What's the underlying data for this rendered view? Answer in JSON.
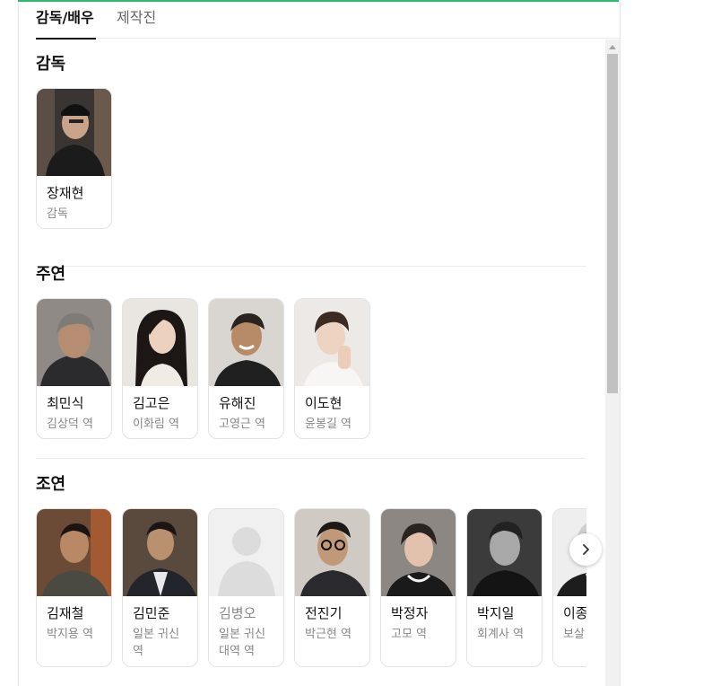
{
  "tabs": [
    {
      "label": "감독/배우",
      "active": true
    },
    {
      "label": "제작진",
      "active": false
    }
  ],
  "sections": [
    {
      "title": "감독",
      "people": [
        {
          "name": "장재현",
          "role": "감독",
          "photo": "person-photo"
        }
      ]
    },
    {
      "title": "주연",
      "people": [
        {
          "name": "최민식",
          "role": "김상덕 역",
          "photo": "person-photo"
        },
        {
          "name": "김고은",
          "role": "이화림 역",
          "photo": "person-photo"
        },
        {
          "name": "유해진",
          "role": "고영근 역",
          "photo": "person-photo"
        },
        {
          "name": "이도현",
          "role": "윤봉길 역",
          "photo": "person-photo"
        }
      ]
    },
    {
      "title": "조연",
      "people": [
        {
          "name": "김재철",
          "role": "박지용 역",
          "photo": "person-photo"
        },
        {
          "name": "김민준",
          "role": "일본 귀신 역",
          "photo": "person-photo"
        },
        {
          "name": "김병오",
          "role": "일본 귀신 대역 역",
          "photo": "placeholder-avatar"
        },
        {
          "name": "전진기",
          "role": "박근현 역",
          "photo": "person-photo"
        },
        {
          "name": "박정자",
          "role": "고모 역",
          "photo": "person-photo"
        },
        {
          "name": "박지일",
          "role": "회계사 역",
          "photo": "person-photo"
        },
        {
          "name": "이종구",
          "role": "보살 역",
          "photo": "person-photo"
        }
      ]
    }
  ],
  "controls": {
    "next_icon": "chevron-right-icon",
    "scroll_up_icon": "scroll-up-arrow-icon"
  },
  "colors": {
    "accent": "#2eb873",
    "text": "#111111",
    "muted": "#888888",
    "border": "#e3e3e3"
  }
}
